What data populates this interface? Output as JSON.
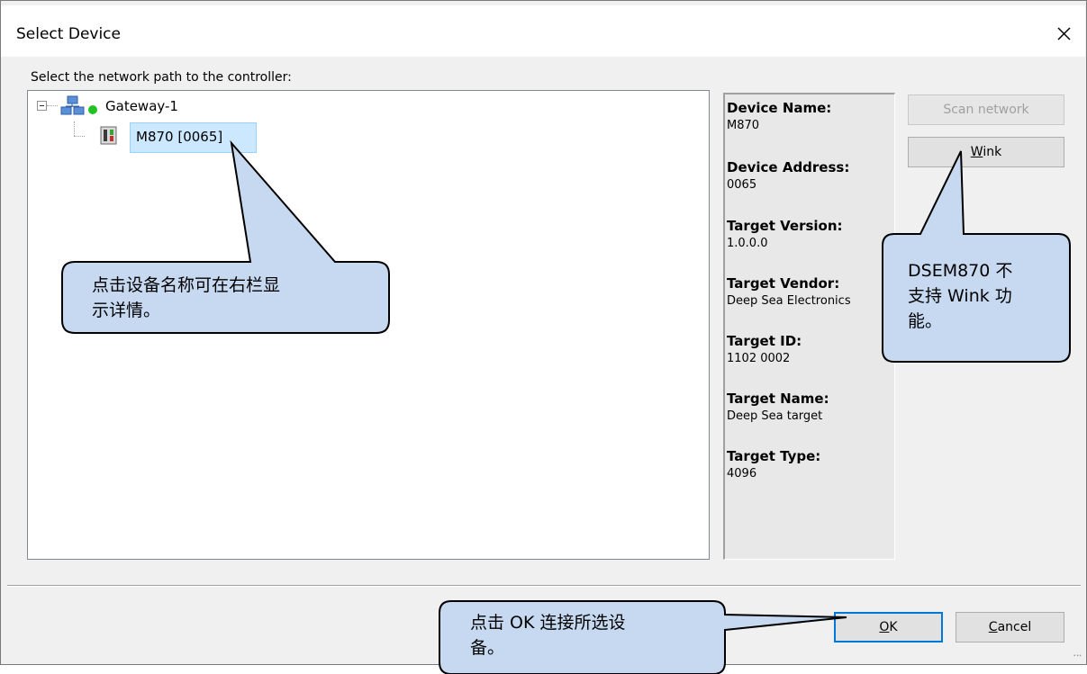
{
  "dialog": {
    "title": "Select Device",
    "prompt": "Select the network path to the controller:"
  },
  "tree": {
    "gateway_label": "Gateway-1",
    "device_label": "M870 [0065]"
  },
  "info": {
    "fields": [
      {
        "label": "Device Name:",
        "value": "M870"
      },
      {
        "label": "Device Address:",
        "value": "0065"
      },
      {
        "label": "Target Version:",
        "value": "1.0.0.0"
      },
      {
        "label": "Target Vendor:",
        "value": "Deep Sea Electronics"
      },
      {
        "label": "Target ID:",
        "value": "1102 0002"
      },
      {
        "label": "Target Name:",
        "value": "Deep Sea target"
      },
      {
        "label": "Target Type:",
        "value": "4096"
      }
    ]
  },
  "buttons": {
    "scan_network": "Scan network",
    "wink_mnemonic": "W",
    "wink_rest": "ink",
    "ok_mnemonic": "O",
    "ok_rest": "K",
    "cancel_mnemonic": "C",
    "cancel_rest": "ancel"
  },
  "callouts": {
    "device_line1": "点击设备名称可在右栏显",
    "device_line2": "示详情。",
    "wink_line1": "DSEM870 不",
    "wink_line2": "支持 Wink 功",
    "wink_line3": "能。",
    "ok_line1": "点击 OK 连接所选设",
    "ok_line2": "备。"
  },
  "colors": {
    "callout_fill": "#c6d9f1",
    "selection": "#cce8ff",
    "default_button_border": "#0078d7"
  }
}
